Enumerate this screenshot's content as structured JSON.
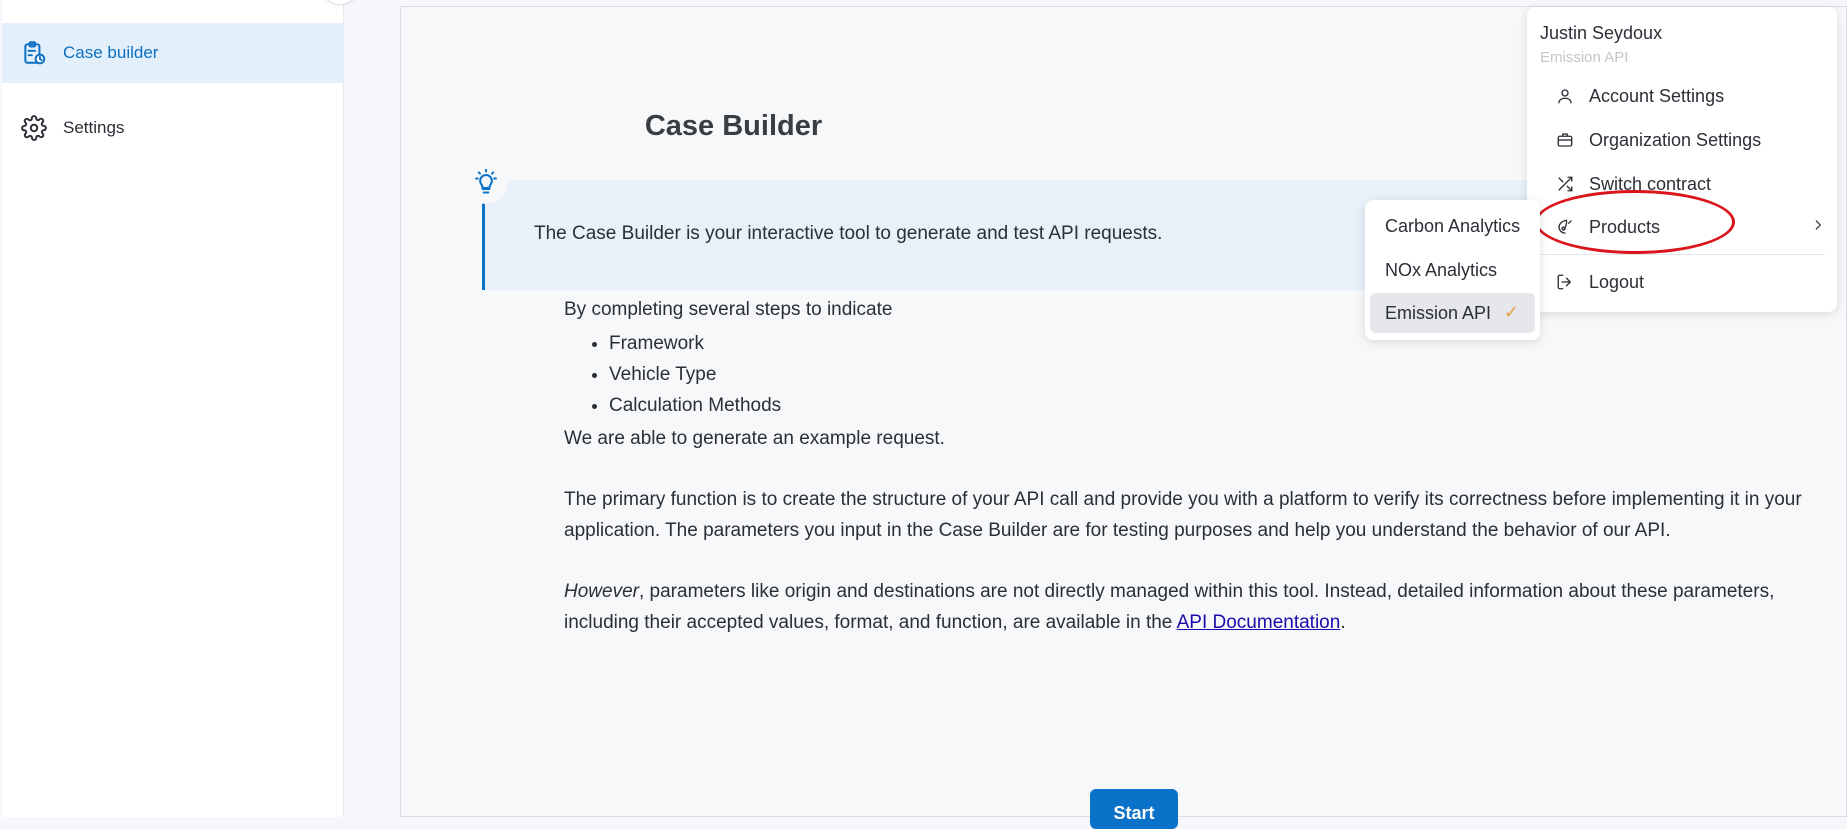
{
  "sidebar": {
    "items": [
      {
        "label": "Case builder",
        "icon": "clipboard-clock-icon",
        "active": true
      },
      {
        "label": "Settings",
        "icon": "gear-icon",
        "active": false
      }
    ]
  },
  "main": {
    "title": "Case Builder",
    "tip": "The Case Builder is your interactive tool to generate and test API requests.",
    "intro": "By completing several steps to indicate",
    "steps": [
      "Framework",
      "Vehicle Type",
      "Calculation Methods"
    ],
    "after_steps": "We are able to generate an example request.",
    "paragraph1": "The primary function is to create the structure of your API call and provide you with a platform to verify its correctness before implementing it in your application. The parameters you input in the Case Builder are for testing purposes and help you understand the behavior of our API.",
    "paragraph2_italic": "However",
    "paragraph2": ", parameters like origin and destinations are not directly managed within this tool. Instead, detailed information about these parameters, including their accepted values, format, and function, are available in the ",
    "doc_link": "API Documentation",
    "paragraph2_end": ".",
    "start_button": "Start"
  },
  "user_menu": {
    "name": "Justin Seydoux",
    "product": "Emission API",
    "items": [
      {
        "label": "Account Settings",
        "icon": "user-icon"
      },
      {
        "label": "Organization Settings",
        "icon": "briefcase-icon"
      },
      {
        "label": "Switch contract",
        "icon": "shuffle-icon"
      },
      {
        "label": "Products",
        "icon": "products-icon"
      },
      {
        "label": "Logout",
        "icon": "logout-icon"
      }
    ]
  },
  "products_submenu": {
    "items": [
      {
        "label": "Carbon Analytics",
        "selected": false
      },
      {
        "label": "NOx Analytics",
        "selected": false
      },
      {
        "label": "Emission API",
        "selected": true
      }
    ]
  },
  "colors": {
    "accent": "#0b72c9",
    "active_bg": "#e3f0fb",
    "highlight_ring": "#d9141b",
    "check": "#e8a33a"
  }
}
